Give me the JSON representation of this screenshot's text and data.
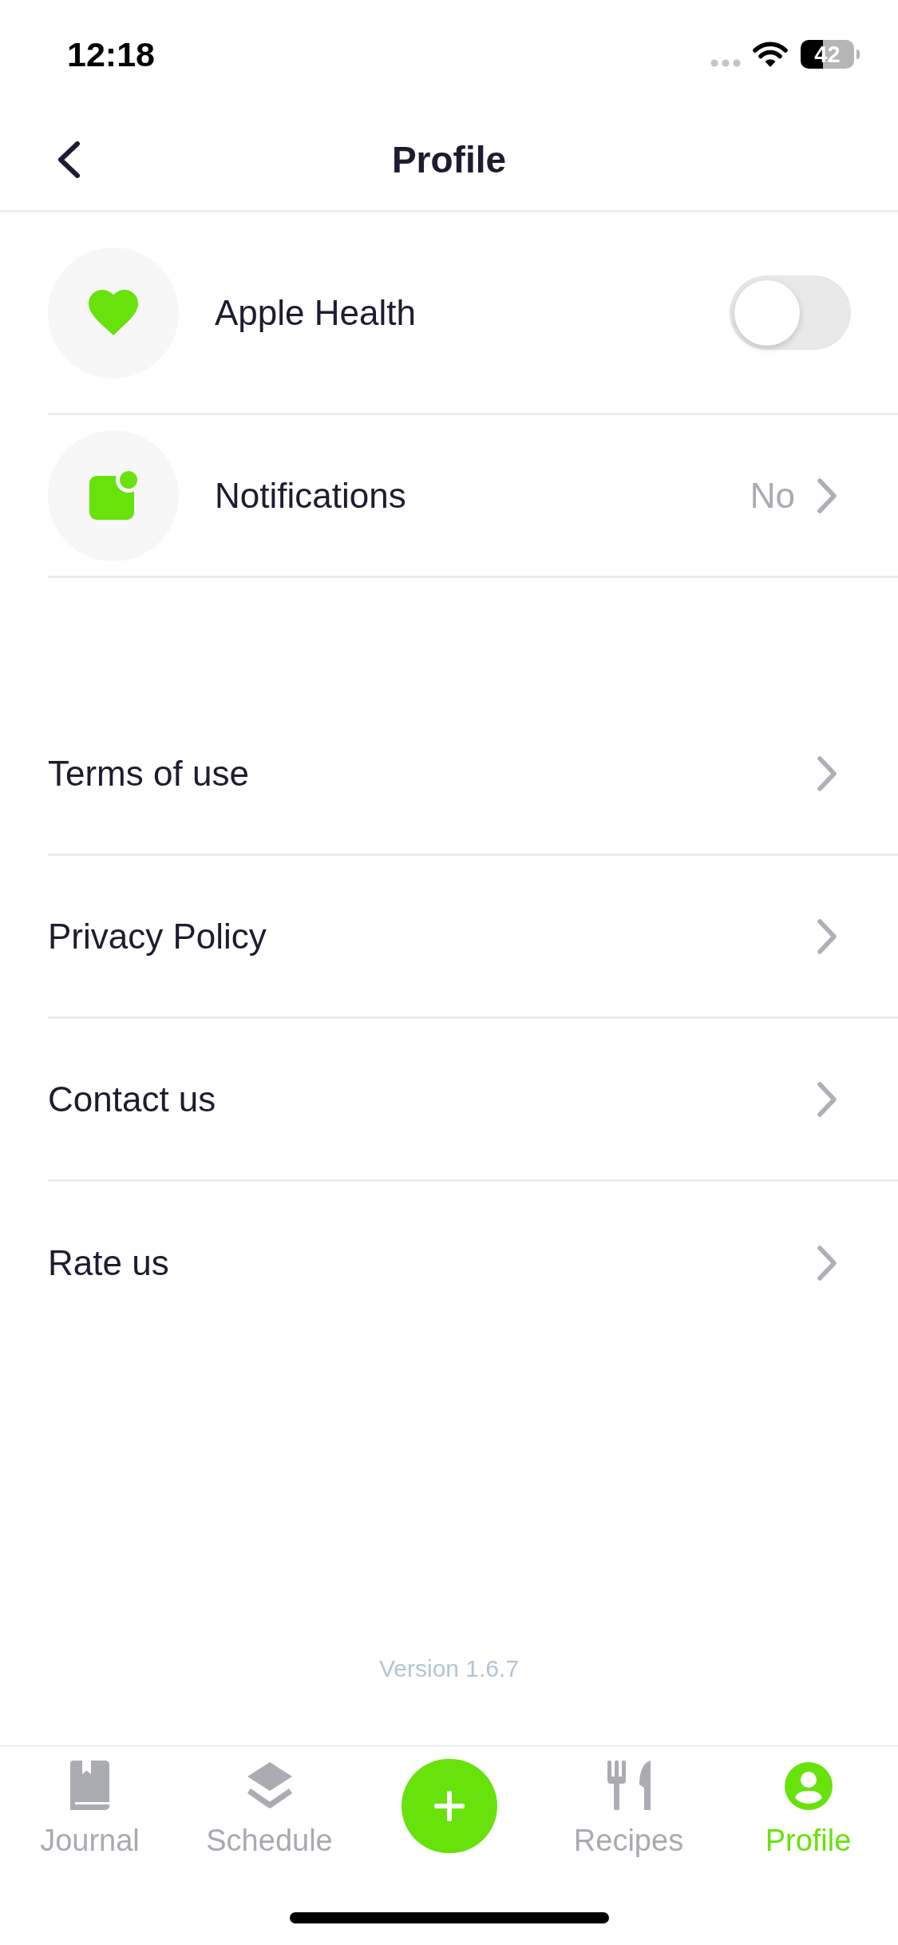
{
  "status_bar": {
    "time": "12:18",
    "battery": "42"
  },
  "header": {
    "title": "Profile"
  },
  "settings": [
    {
      "kind": "toggle",
      "label": "Apple Health",
      "on": false
    },
    {
      "kind": "link",
      "label": "Notifications",
      "value": "No"
    }
  ],
  "links": [
    {
      "label": "Terms of use"
    },
    {
      "label": "Privacy Policy"
    },
    {
      "label": "Contact us"
    },
    {
      "label": "Rate us"
    }
  ],
  "version": "Version 1.6.7",
  "tab_bar": {
    "tabs": [
      {
        "label": "Journal",
        "selected": false
      },
      {
        "label": "Schedule",
        "selected": false
      },
      {
        "label": "Recipes",
        "selected": false
      },
      {
        "label": "Profile",
        "selected": true
      }
    ]
  }
}
